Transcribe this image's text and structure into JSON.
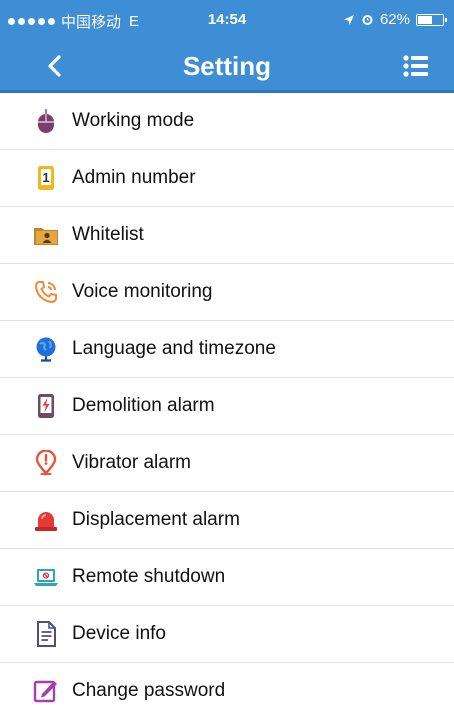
{
  "status_bar": {
    "carrier": "中国移动",
    "network": "E",
    "time": "14:54",
    "battery": "62%",
    "battery_level": 0.62
  },
  "nav": {
    "title": "Setting",
    "back_icon": "chevron-left-icon",
    "menu_icon": "list-menu-icon"
  },
  "colors": {
    "header": "#3d8ed4",
    "divider": "#e2e2e2"
  },
  "settings": [
    {
      "label": "Working mode",
      "icon": "mouse-icon"
    },
    {
      "label": "Admin number",
      "icon": "phone-number-icon"
    },
    {
      "label": "Whitelist",
      "icon": "contact-folder-icon"
    },
    {
      "label": "Voice monitoring",
      "icon": "phone-call-icon"
    },
    {
      "label": "Language and timezone",
      "icon": "globe-icon"
    },
    {
      "label": "Demolition alarm",
      "icon": "phone-alert-icon"
    },
    {
      "label": "Vibrator alarm",
      "icon": "location-alert-icon"
    },
    {
      "label": "Displacement alarm",
      "icon": "siren-icon"
    },
    {
      "label": "Remote shutdown",
      "icon": "laptop-icon"
    },
    {
      "label": "Device info",
      "icon": "document-icon"
    },
    {
      "label": "Change password",
      "icon": "edit-icon"
    }
  ]
}
